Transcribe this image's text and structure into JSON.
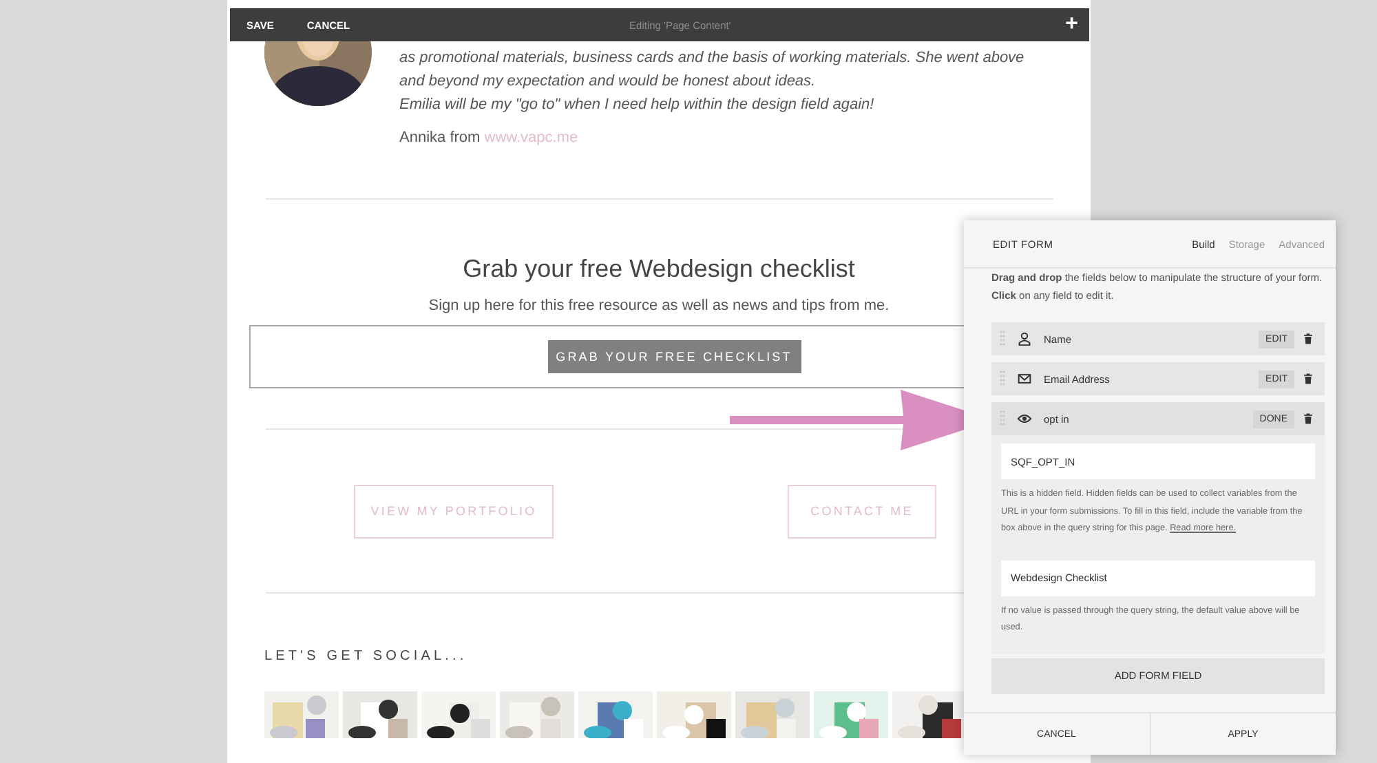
{
  "topbar": {
    "save": "SAVE",
    "cancel": "CANCEL",
    "title": "Editing 'Page Content'",
    "add": "+"
  },
  "testimonial": {
    "lines": [
      "as promotional materials, business cards and the basis of working materials. She went above",
      "and beyond my expectation and would be honest about ideas.",
      "Emilia will be my \"go to\" when I need help within the design field again!"
    ],
    "signature": "Annika from",
    "link": "www.vapc.me"
  },
  "signup": {
    "heading": "Grab your free Webdesign checklist",
    "text": "Sign up here for this free resource as well as news and tips from me.",
    "button": "GRAB YOUR FREE CHECKLIST"
  },
  "links": [
    "VIEW MY PORTFOLIO",
    "CONTACT ME"
  ],
  "social": {
    "heading": "LET'S GET SOCIAL..."
  },
  "edit_form": {
    "title": "EDIT FORM",
    "tabs": [
      {
        "label": "Build",
        "selected": true
      },
      {
        "label": "Storage",
        "selected": false
      },
      {
        "label": "Advanced",
        "selected": false
      }
    ],
    "intro": "**Drag and drop** the fields below to manipulate the structure of your form. **Click** on any field to edit it.",
    "fields": [
      {
        "kind": "name",
        "label": "Name",
        "action": "EDIT",
        "expanded": false
      },
      {
        "kind": "email",
        "label": "Email Address",
        "action": "EDIT",
        "expanded": false
      },
      {
        "kind": "hidden",
        "label": "opt in",
        "action": "DONE",
        "expanded": true,
        "key": "SQF_OPT_IN",
        "help": "This is a hidden field. Hidden fields can be used to collect variables from the URL in your form submissions. To fill in this field, include the variable from the box above in the query string for this page.",
        "help_link": "Read more here.",
        "default_value": "Webdesign Checklist",
        "default_help": "If no value is passed through the query string, the default value above will be used."
      }
    ],
    "add_button": "ADD FORM FIELD",
    "buttons": [
      "CANCEL",
      "APPLY"
    ]
  }
}
